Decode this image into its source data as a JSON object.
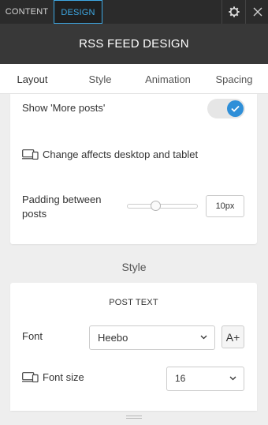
{
  "topbar": {
    "tabs": [
      {
        "label": "CONTENT",
        "active": false
      },
      {
        "label": "DESIGN",
        "active": true
      }
    ],
    "icons": [
      "gear-icon",
      "close-icon"
    ]
  },
  "panel_title": "RSS FEED DESIGN",
  "subtabs": [
    {
      "label": "Layout",
      "active": true
    },
    {
      "label": "Style",
      "active": false
    },
    {
      "label": "Animation",
      "active": false
    },
    {
      "label": "Spacing",
      "active": false
    }
  ],
  "layout_card": {
    "show_more_posts_label": "Show 'More posts'",
    "show_more_posts_on": true,
    "device_note": "Change affects desktop and tablet",
    "padding_label": "Padding between posts",
    "padding_value": "10px"
  },
  "style_section": {
    "title": "Style",
    "post_text_heading": "POST TEXT",
    "font_label": "Font",
    "font_value": "Heebo",
    "font_size_button": "A+",
    "font_size_label": "Font size",
    "font_size_value": "16"
  },
  "colors": {
    "accent": "#3ea8e3",
    "toggle_on": "#2f8fd8",
    "topbar_bg": "#2b2b2b",
    "titlebar_bg": "#383838"
  }
}
